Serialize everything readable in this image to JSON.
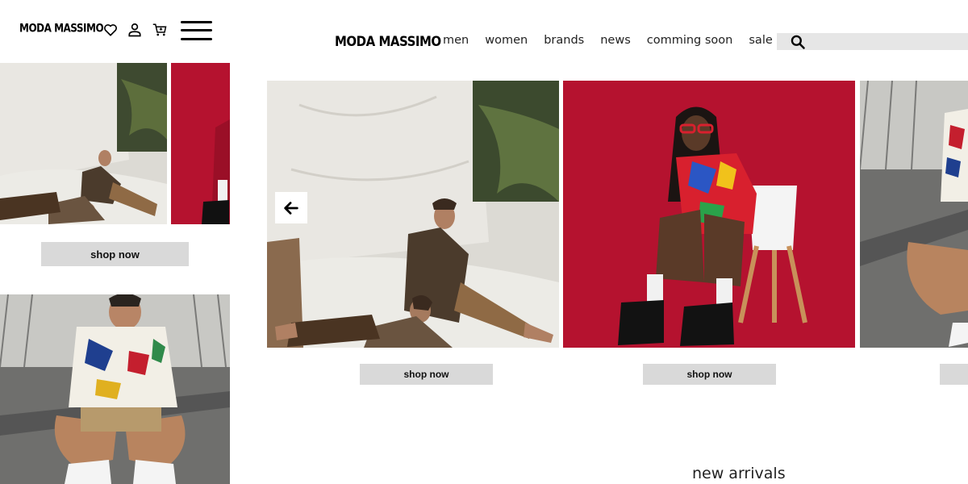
{
  "brand": {
    "logo_text": "MODA MASSIMO"
  },
  "colors": {
    "accent_red": "#b5122f",
    "button_gray": "#d9d9d9",
    "search_gray": "#e6e6e6"
  },
  "mobile": {
    "header": {
      "icons": [
        "heart-icon",
        "user-icon",
        "cart-icon",
        "hamburger-menu-icon"
      ]
    },
    "shop_now_label": "shop now"
  },
  "desktop": {
    "nav": {
      "items": [
        {
          "label": "men"
        },
        {
          "label": "women"
        },
        {
          "label": "brands"
        },
        {
          "label": "news"
        },
        {
          "label": "comming soon"
        },
        {
          "label": "sale"
        }
      ]
    },
    "search": {
      "icon": "search-icon",
      "placeholder": "",
      "value": ""
    },
    "carousel": {
      "prev_icon": "arrow-left-icon",
      "slides": [
        {
          "button_label": "shop now"
        },
        {
          "button_label": "shop now"
        },
        {
          "button_label": ""
        }
      ]
    },
    "section_title": "new arrivals"
  }
}
